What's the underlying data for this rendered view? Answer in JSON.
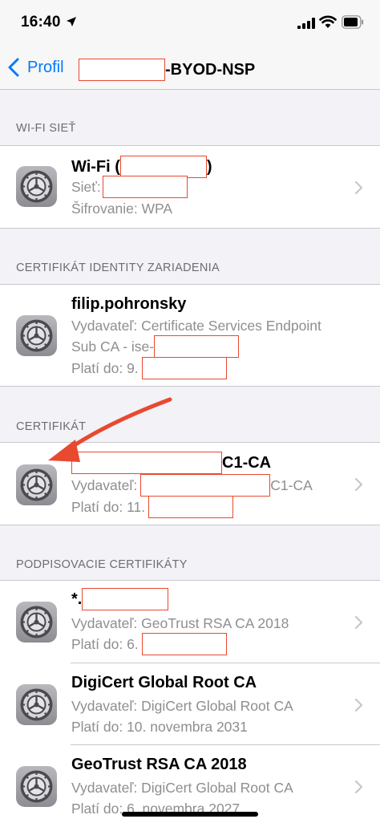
{
  "status_bar": {
    "time": "16:40"
  },
  "nav": {
    "back_label": "Profil",
    "title_suffix": "-BYOD-NSP"
  },
  "sections": {
    "wifi": {
      "header": "WI-FI SIEŤ",
      "row": {
        "title_prefix": "Wi-Fi (",
        "title_suffix": ")",
        "network_label": "Sieť:",
        "encryption": "Šifrovanie: WPA"
      }
    },
    "identity": {
      "header": "CERTIFIKÁT IDENTITY ZARIADENIA",
      "row": {
        "title": "filip.pohronsky",
        "issuer_line1": "Vydavateľ: Certificate Services Endpoint",
        "issuer_line2": "Sub CA - ise-",
        "valid": "Platí do: 9."
      }
    },
    "certificate": {
      "header": "CERTIFIKÁT",
      "row": {
        "title_suffix": "C1-CA",
        "issuer_label": "Vydavateľ:",
        "issuer_suffix": "C1-CA",
        "valid": "Platí do: 11."
      }
    },
    "signing": {
      "header": "PODPISOVACIE CERTIFIKÁTY",
      "rows": [
        {
          "title": "*.",
          "issuer": "Vydavateľ: GeoTrust RSA CA 2018",
          "valid": "Platí do: 6."
        },
        {
          "title": "DigiCert Global Root CA",
          "issuer": "Vydavateľ: DigiCert Global Root CA",
          "valid": "Platí do: 10. novembra 2031"
        },
        {
          "title": "GeoTrust RSA CA 2018",
          "issuer": "Vydavateľ: DigiCert Global Root CA",
          "valid": "Platí do: 6. novembra 2027"
        }
      ]
    }
  },
  "colors": {
    "accent": "#007aff",
    "annotation": "#e8492f",
    "secondary_text": "#8e8e93",
    "header_text": "#6d6d72"
  }
}
